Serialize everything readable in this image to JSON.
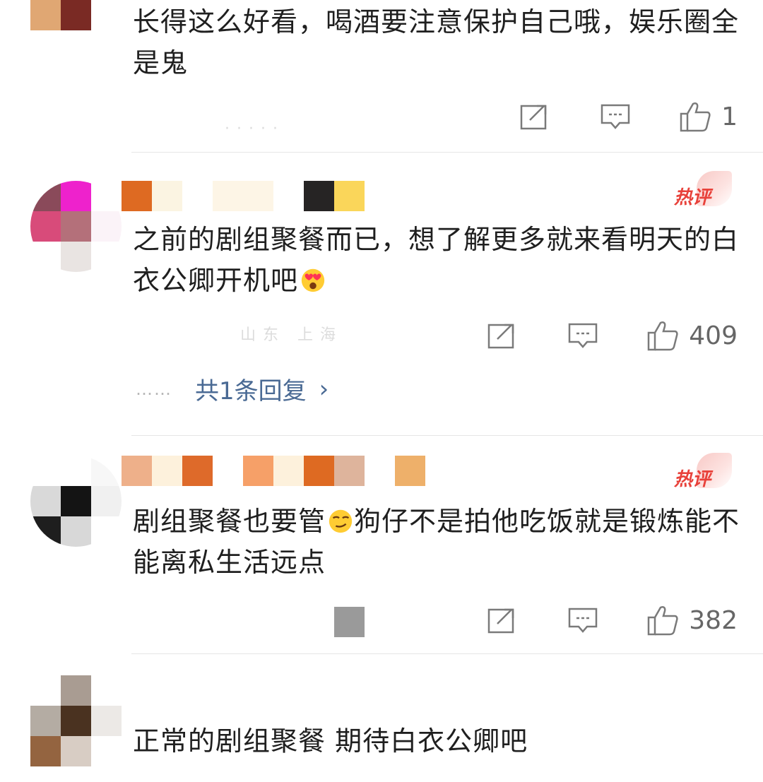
{
  "comments": [
    {
      "text": "长得这么好看，喝酒要注意保护自己哦，娱乐圈全是鬼",
      "likes": "1",
      "hot": false
    },
    {
      "text": "之前的剧组聚餐而已，想了解更多就来看明天的白衣公卿开机吧",
      "emoji": "heart-eyes-emoji",
      "likes": "409",
      "hot": true,
      "hot_label": "热评",
      "faded_meta": "山东 上海",
      "replies_label": "共1条回复",
      "replies_dots": "……"
    },
    {
      "text_before": "剧组聚餐也要管",
      "emoji": "smirk-emoji",
      "text_after": "狗仔不是拍他吃饭就是锻炼能不能离私生活远点",
      "likes": "382",
      "hot": true,
      "hot_label": "热评"
    },
    {
      "text": "正常的剧组聚餐 期待白衣公卿吧",
      "hot": false
    }
  ],
  "colors": {
    "hot_red": "#e8413a",
    "link_blue": "#4a6a94",
    "divider": "#e6e6e6",
    "icon_gray": "#7a7a7a"
  },
  "icons": [
    "share-icon",
    "comment-icon",
    "like-icon",
    "chevron-right-icon"
  ]
}
